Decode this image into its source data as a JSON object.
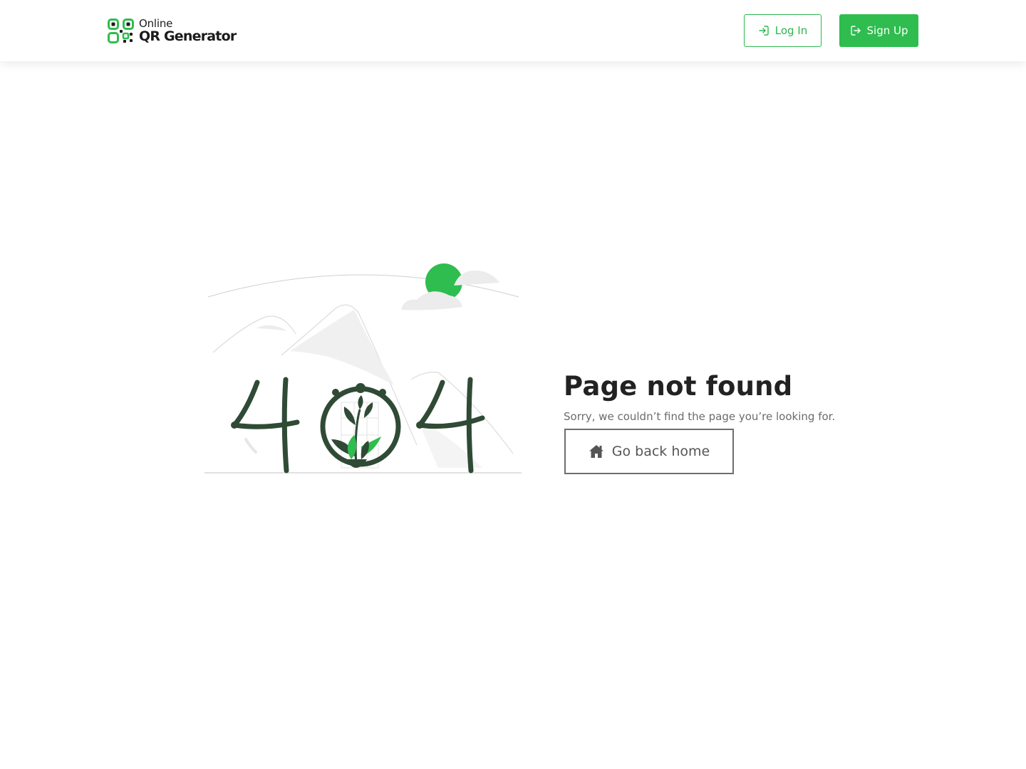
{
  "header": {
    "logo": {
      "line1": "Online",
      "line2": "QR Generator",
      "icon": "qr-code-icon",
      "color": "#2ebd4e"
    },
    "login": {
      "label": "Log In",
      "icon": "login-icon"
    },
    "signup": {
      "label": "Sign Up",
      "icon": "logout-icon"
    }
  },
  "main": {
    "illustration": {
      "text": "404",
      "icon": "plant-404-illustration"
    },
    "title": "Page not found",
    "subtitle": "Sorry, we couldn’t find the page you’re looking for.",
    "home_button": {
      "label": "Go back home",
      "icon": "home-icon"
    }
  },
  "colors": {
    "accent": "#2ebd4e",
    "dark_green": "#2f4a35",
    "text": "#222222",
    "muted": "#6b6b6b"
  }
}
